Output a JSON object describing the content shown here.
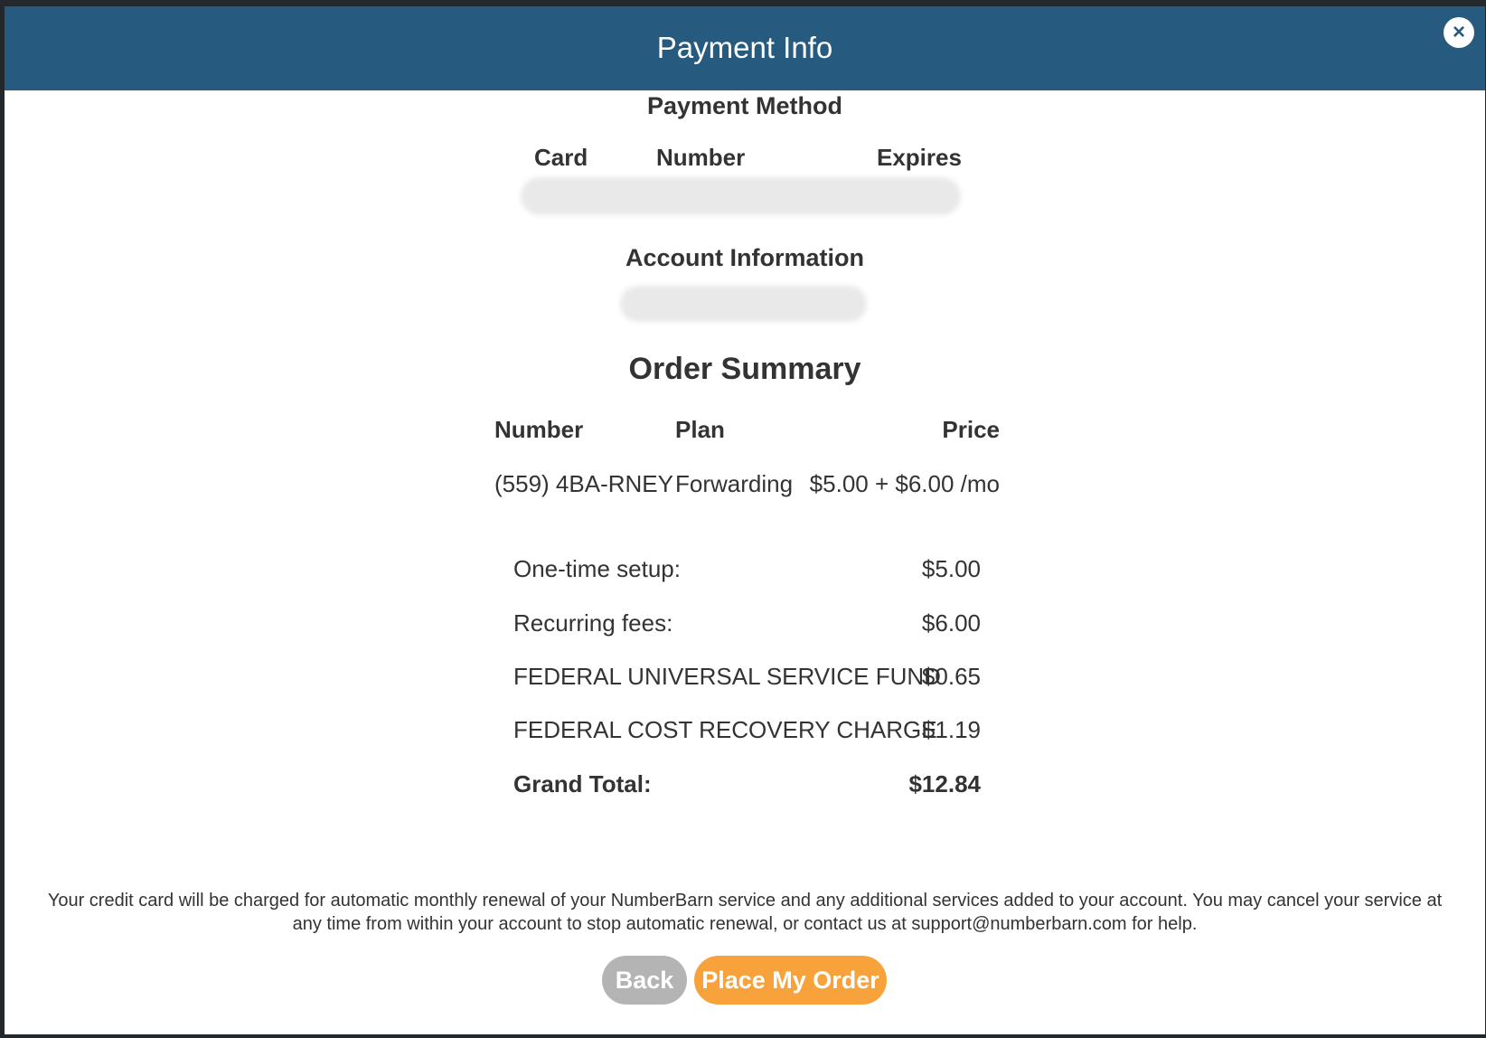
{
  "modal": {
    "title": "Payment Info",
    "close_label": "×"
  },
  "payment_method": {
    "heading": "Payment Method",
    "columns": [
      "Card",
      "Number",
      "Expires"
    ]
  },
  "account_information": {
    "heading": "Account Information"
  },
  "order_summary": {
    "heading": "Order Summary",
    "columns": [
      "Number",
      "Plan",
      "Price"
    ],
    "rows": [
      {
        "number": "(559) 4BA-RNEY",
        "plan": "Forwarding",
        "price": "$5.00 + $6.00 /mo"
      }
    ],
    "totals": [
      {
        "label": "One-time setup:",
        "value": "$5.00"
      },
      {
        "label": "Recurring fees:",
        "value": "$6.00"
      },
      {
        "label": "FEDERAL UNIVERSAL SERVICE FUND",
        "value": "$0.65"
      },
      {
        "label": "FEDERAL COST RECOVERY CHARGE",
        "value": "$1.19"
      }
    ],
    "grand_total": {
      "label": "Grand Total:",
      "value": "$12.84"
    }
  },
  "disclaimer": "Your credit card will be charged for automatic monthly renewal of your NumberBarn service and any additional services added to your account. You may cancel your service at any time from within your account to stop automatic renewal, or contact us at support@numberbarn.com for help.",
  "buttons": {
    "back": "Back",
    "place_order": "Place My Order"
  },
  "colors": {
    "header": "#265a7e",
    "back_button": "#b4b4b4",
    "order_button": "#f7a23b"
  }
}
